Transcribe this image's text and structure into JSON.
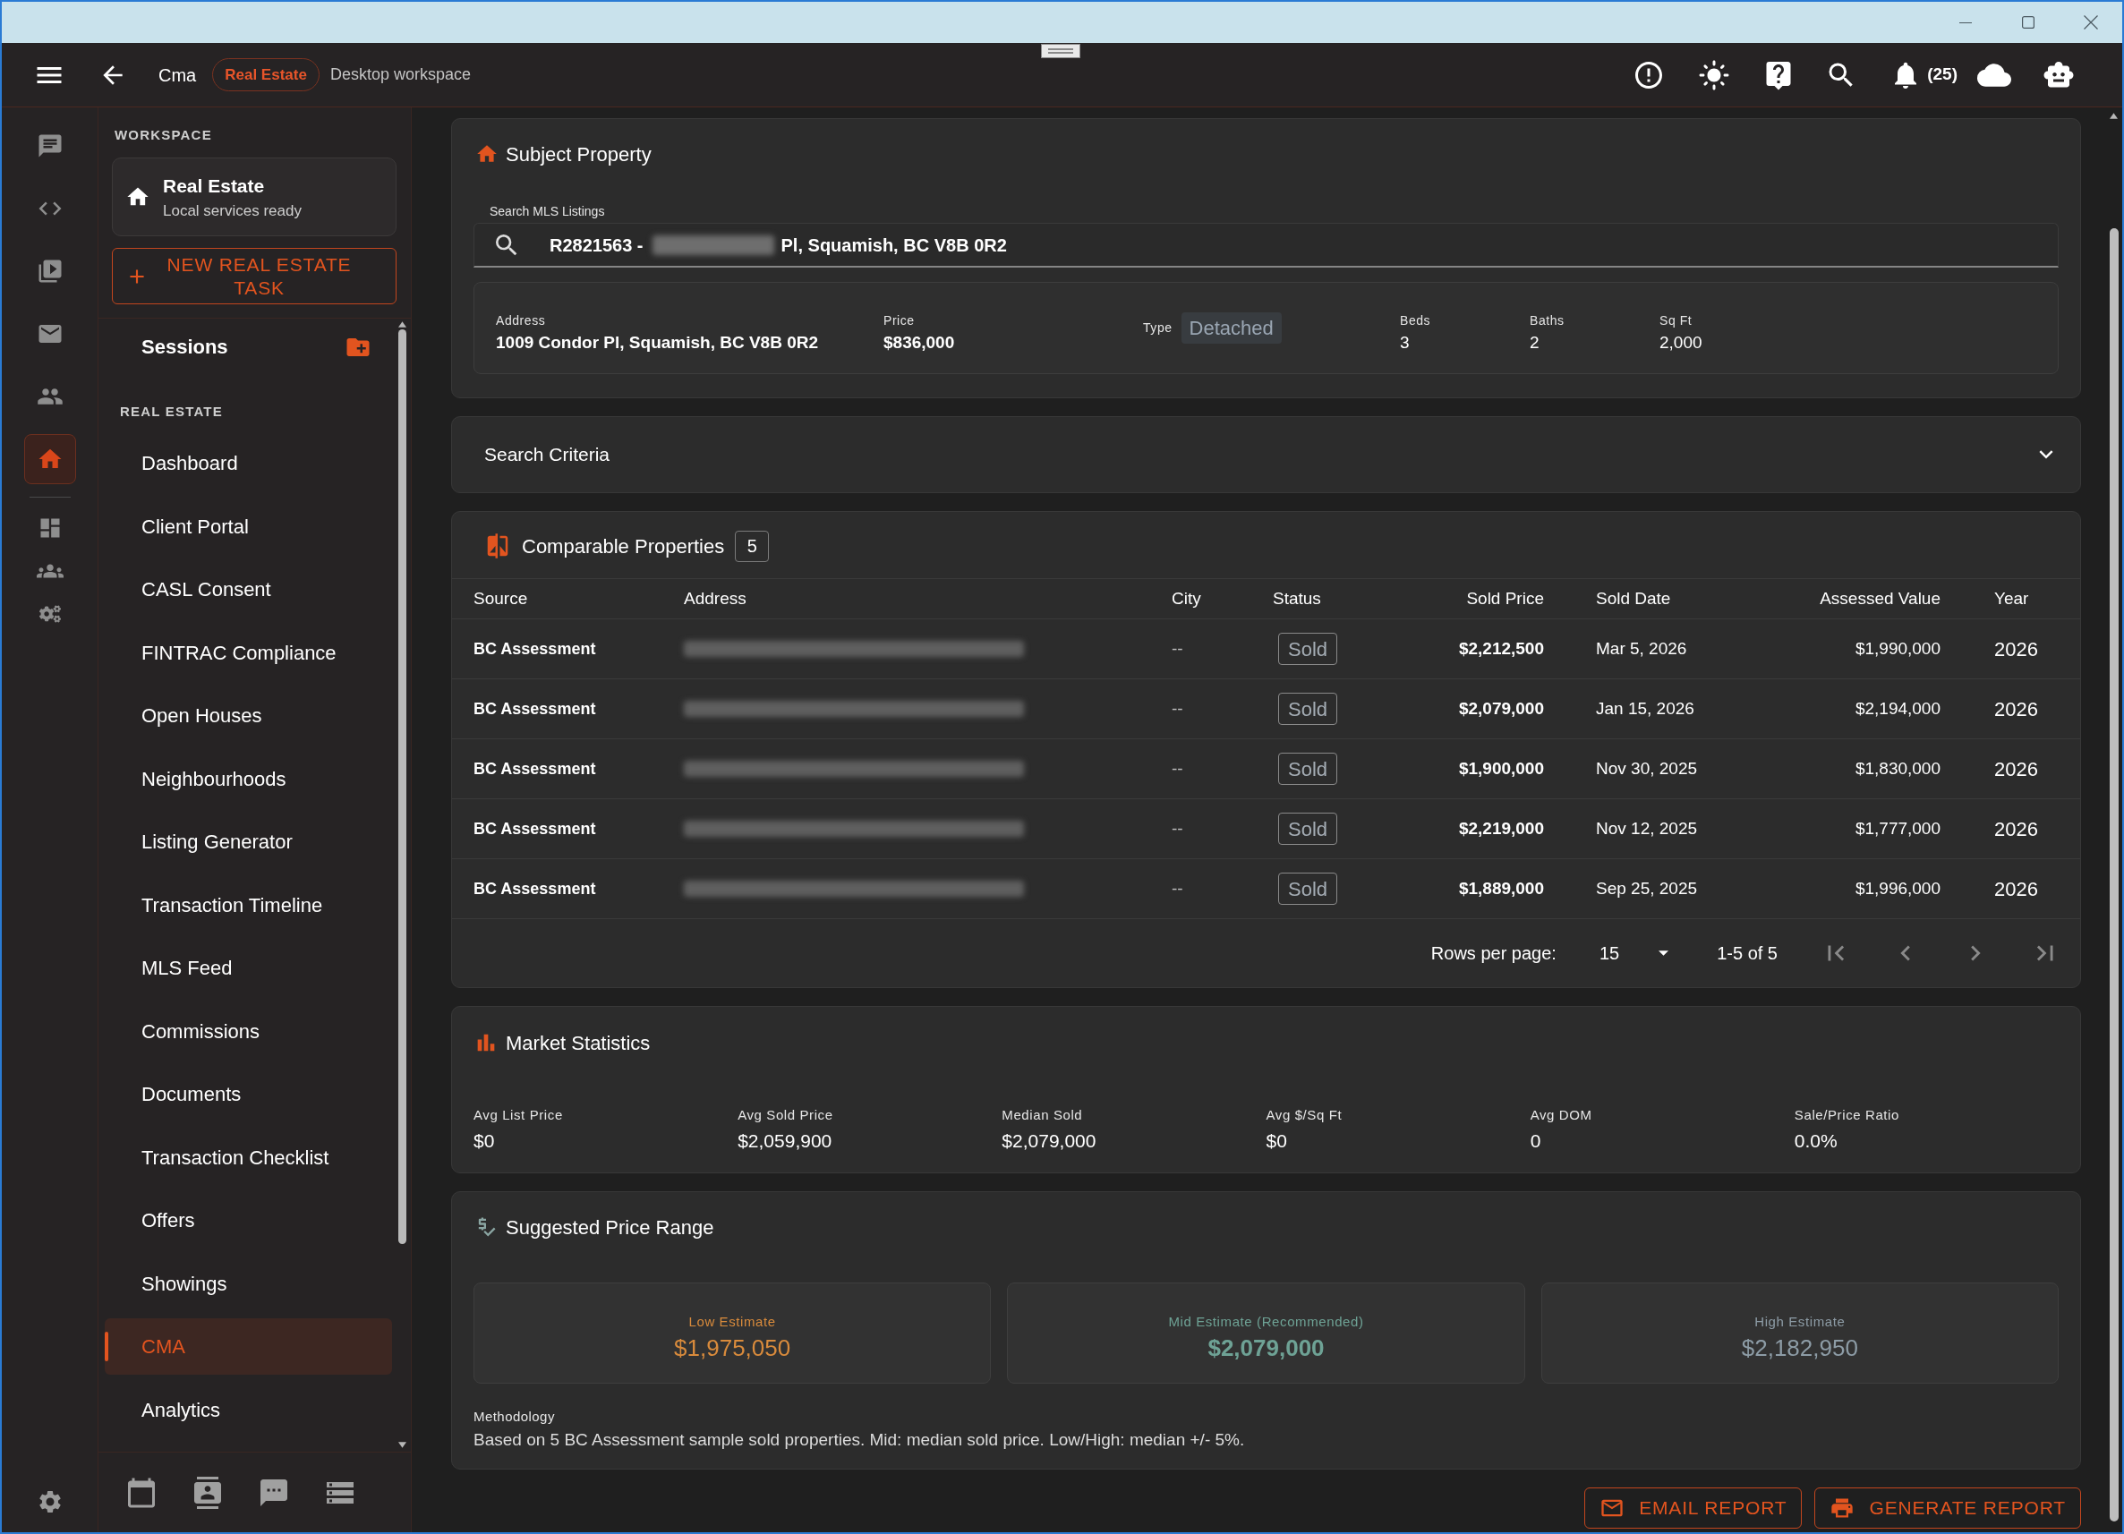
{
  "header": {
    "title": "Cma",
    "badge": "Real Estate",
    "subtitle": "Desktop workspace",
    "notifications": "(25)"
  },
  "rail": {
    "top": [
      {
        "kind": "chat",
        "selected": false
      },
      {
        "kind": "code",
        "selected": false
      },
      {
        "kind": "video",
        "selected": false
      },
      {
        "kind": "mail",
        "selected": false
      },
      {
        "kind": "people",
        "selected": false
      },
      {
        "kind": "home",
        "selected": true
      }
    ],
    "tools": [
      {
        "kind": "dashboard",
        "selected": false
      },
      {
        "kind": "groups",
        "selected": false
      },
      {
        "kind": "settings",
        "selected": false
      }
    ]
  },
  "sidebar": {
    "section_label": "WORKSPACE",
    "workspace": {
      "title": "Real Estate",
      "subtitle": "Local services ready"
    },
    "new_task_button": "NEW REAL ESTATE TASK",
    "sessions_label": "Sessions",
    "group_label": "REAL ESTATE",
    "items": [
      {
        "label": "Dashboard",
        "selected": false
      },
      {
        "label": "Client Portal",
        "selected": false
      },
      {
        "label": "CASL Consent",
        "selected": false
      },
      {
        "label": "FINTRAC Compliance",
        "selected": false
      },
      {
        "label": "Open Houses",
        "selected": false
      },
      {
        "label": "Neighbourhoods",
        "selected": false
      },
      {
        "label": "Listing Generator",
        "selected": false
      },
      {
        "label": "Transaction Timeline",
        "selected": false
      },
      {
        "label": "MLS Feed",
        "selected": false
      },
      {
        "label": "Commissions",
        "selected": false
      },
      {
        "label": "Documents",
        "selected": false
      },
      {
        "label": "Transaction Checklist",
        "selected": false
      },
      {
        "label": "Offers",
        "selected": false
      },
      {
        "label": "Showings",
        "selected": false
      },
      {
        "label": "CMA",
        "selected": true
      },
      {
        "label": "Analytics",
        "selected": false
      }
    ]
  },
  "subject_property": {
    "title": "Subject Property",
    "search": {
      "label": "Search MLS Listings",
      "value_start": "R2821563 -",
      "value_end": "Pl, Squamish, BC V8B 0R2"
    },
    "details": [
      {
        "kind": "strong",
        "label": "Address",
        "value": "1009 Condor Pl, Squamish, BC V8B 0R2"
      },
      {
        "kind": "strong",
        "label": "Price",
        "value": "$836,000"
      },
      {
        "kind": "chip",
        "label": "Type",
        "value": "Detached"
      },
      {
        "kind": "plain",
        "label": "Beds",
        "value": "3"
      },
      {
        "kind": "plain",
        "label": "Baths",
        "value": "2"
      },
      {
        "kind": "plain",
        "label": "Sq Ft",
        "value": "2,000"
      }
    ]
  },
  "search_criteria": {
    "title": "Search Criteria",
    "expanded": false
  },
  "comparables": {
    "title": "Comparable Properties",
    "count": "5",
    "columns": [
      "Source",
      "Address",
      "City",
      "Status",
      "Sold Price",
      "Sold Date",
      "Assessed Value",
      "Year"
    ],
    "rows": [
      {
        "source": "BC Assessment",
        "city": "--",
        "status": "Sold",
        "sold_price": "$2,212,500",
        "sold_date": "Mar 5, 2026",
        "assessed_value": "$1,990,000",
        "year": "2026"
      },
      {
        "source": "BC Assessment",
        "city": "--",
        "status": "Sold",
        "sold_price": "$2,079,000",
        "sold_date": "Jan 15, 2026",
        "assessed_value": "$2,194,000",
        "year": "2026"
      },
      {
        "source": "BC Assessment",
        "city": "--",
        "status": "Sold",
        "sold_price": "$1,900,000",
        "sold_date": "Nov 30, 2025",
        "assessed_value": "$1,830,000",
        "year": "2026"
      },
      {
        "source": "BC Assessment",
        "city": "--",
        "status": "Sold",
        "sold_price": "$2,219,000",
        "sold_date": "Nov 12, 2025",
        "assessed_value": "$1,777,000",
        "year": "2026"
      },
      {
        "source": "BC Assessment",
        "city": "--",
        "status": "Sold",
        "sold_price": "$1,889,000",
        "sold_date": "Sep 25, 2025",
        "assessed_value": "$1,996,000",
        "year": "2026"
      }
    ],
    "pagination": {
      "rows_per_page_label": "Rows per page:",
      "rows_per_page": "15",
      "range": "1-5 of 5"
    }
  },
  "market_statistics": {
    "title": "Market Statistics",
    "stats": [
      {
        "label": "Avg List Price",
        "value": "$0"
      },
      {
        "label": "Avg Sold Price",
        "value": "$2,059,900"
      },
      {
        "label": "Median Sold",
        "value": "$2,079,000"
      },
      {
        "label": "Avg $/Sq Ft",
        "value": "$0"
      },
      {
        "label": "Avg DOM",
        "value": "0"
      },
      {
        "label": "Sale/Price Ratio",
        "value": "0.0%"
      }
    ]
  },
  "price_range": {
    "title": "Suggested Price Range",
    "estimates": [
      {
        "label": "Low Estimate",
        "value": "$1,975,050",
        "color": "#d98b3c",
        "recommended": false
      },
      {
        "label": "Mid Estimate (Recommended)",
        "value": "$2,079,000",
        "color": "#6ea295",
        "recommended": true
      },
      {
        "label": "High Estimate",
        "value": "$2,182,950",
        "color": "#8d9ca6",
        "recommended": false
      }
    ],
    "methodology_label": "Methodology",
    "methodology": "Based on 5 BC Assessment sample sold properties. Mid: median sold price. Low/High: median +/- 5%."
  },
  "actions": [
    {
      "kind": "email",
      "label": "EMAIL REPORT"
    },
    {
      "kind": "print",
      "label": "GENERATE REPORT"
    }
  ]
}
